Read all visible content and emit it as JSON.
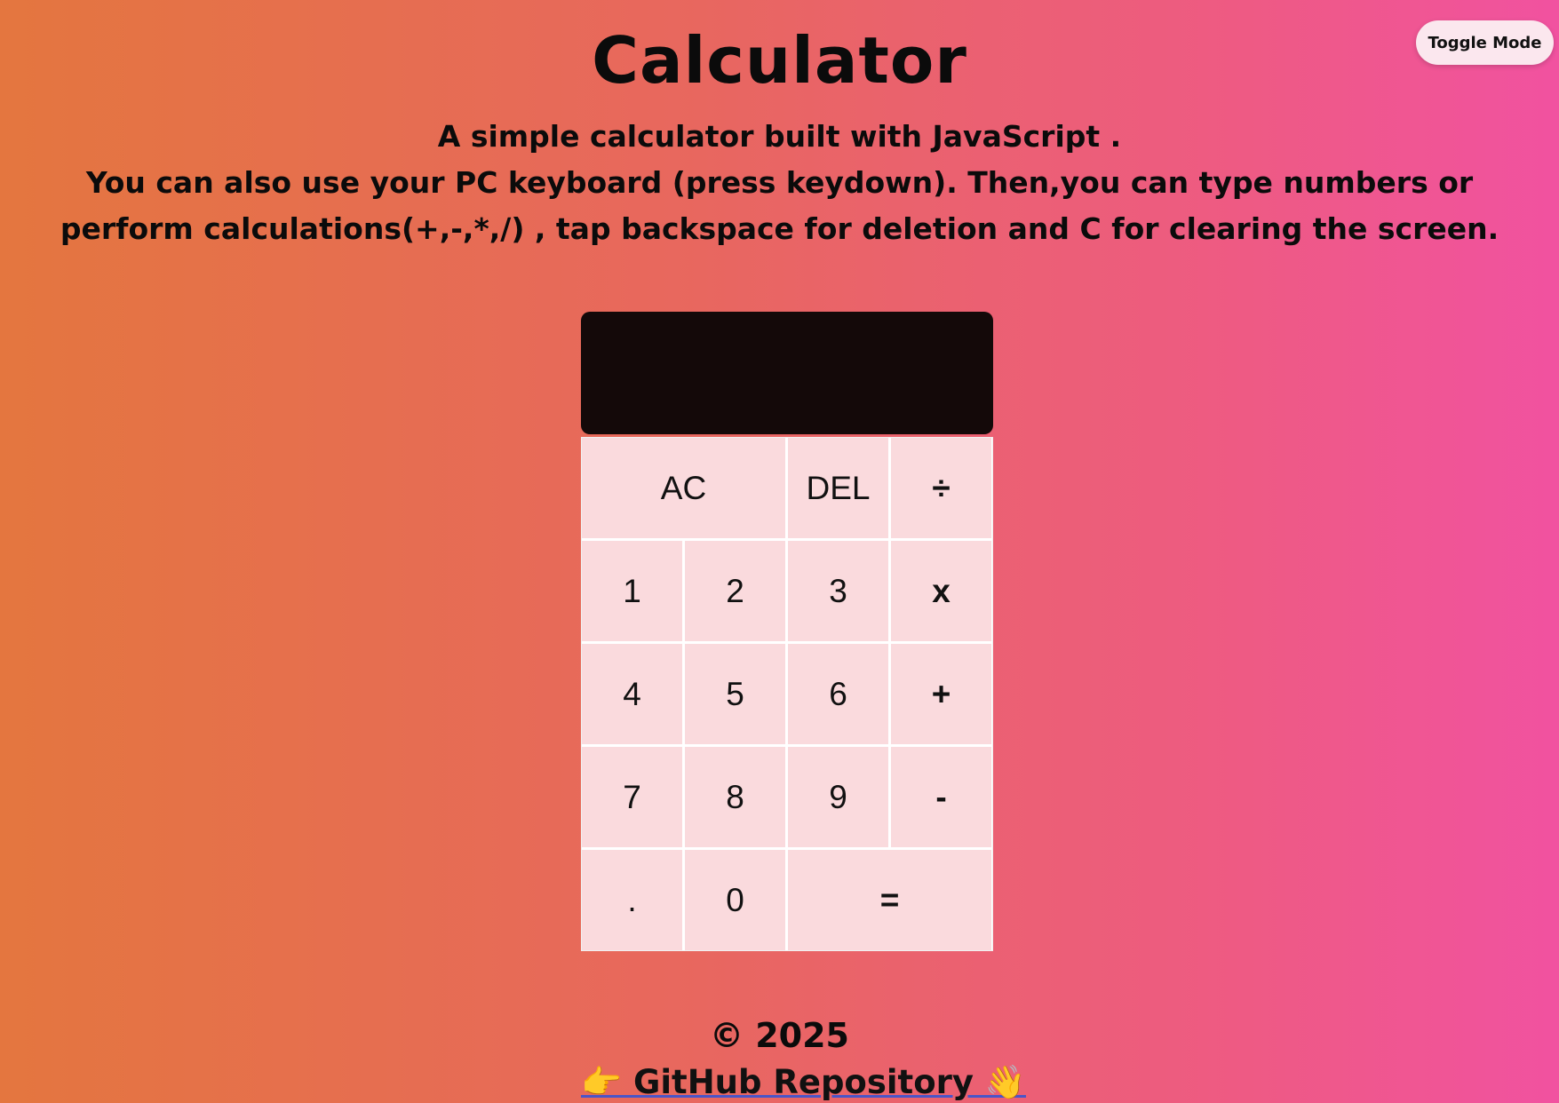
{
  "header": {
    "toggle_label": "Toggle Mode",
    "title": "Calculator",
    "description_line1": "A simple calculator built with JavaScript .",
    "description_line2": "You can also use your PC keyboard (press keydown). Then,you can type numbers or perform calculations(+,-,*,/) , tap backspace for deletion and C for clearing the screen."
  },
  "calculator": {
    "display_value": "",
    "keys": {
      "ac": "AC",
      "del": "DEL",
      "divide": "÷",
      "one": "1",
      "two": "2",
      "three": "3",
      "multiply": "x",
      "four": "4",
      "five": "5",
      "six": "6",
      "plus": "+",
      "seven": "7",
      "eight": "8",
      "nine": "9",
      "minus": "-",
      "dot": ".",
      "zero": "0",
      "equals": "="
    }
  },
  "footer": {
    "copyright": "© 2025",
    "link_text": "👉 GitHub Repository 👋"
  }
}
